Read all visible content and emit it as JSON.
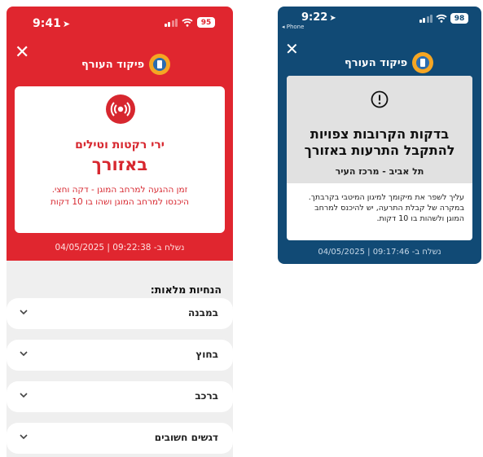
{
  "left_screen": {
    "status_bar": {
      "time": "9:41",
      "battery": "95",
      "location_icon": "location-arrow-icon"
    },
    "header": {
      "app_name": "פיקוד העורף",
      "close_icon": "close-icon",
      "logo": "home-front-command-logo"
    },
    "alert": {
      "icon": "alarm-siren-icon",
      "subtitle": "ירי רקטות וטילים",
      "title": "באזורך",
      "description_line1": "זמן ההגעה למרחב המוגן - דקה וחצי.",
      "description_line2": "היכנסו למרחב המוגן ושהו בו 10 דקות"
    },
    "sent_text": "04/05/2025 | 09:22:38 -נשלח ב",
    "instructions_header": "הנחיות מלאות:",
    "instructions": [
      {
        "label": "במבנה"
      },
      {
        "label": "בחוץ"
      },
      {
        "label": "ברכב"
      },
      {
        "label": "דגשים חשובים"
      }
    ],
    "colors": {
      "alert_red": "#e0262f",
      "background": "#efefef"
    }
  },
  "right_screen": {
    "status_bar": {
      "time": "9:22",
      "back_label": "◂ Phone",
      "battery": "98"
    },
    "header": {
      "app_name": "פיקוד העורף",
      "close_icon": "close-icon",
      "logo": "home-front-command-logo"
    },
    "info": {
      "icon": "exclamation-circle-icon",
      "title_line1": "בדקות הקרובות צפויות",
      "title_line2": "להתקבל התרעות באזורך",
      "location": "תל אביב - מרכז העיר",
      "description_line1": "עליך לשפר את מיקומך למיגון המיטבי בקרבתך.",
      "description_line2": "במקרה של קבלת התרעה, יש להיכנס למרחב",
      "description_line3": "המוגן ולשהות בו 10 דקות."
    },
    "sent_text": "04/05/2025 | 09:17:46 -נשלח ב",
    "colors": {
      "background": "#114a75",
      "card_top": "#e1e1e1"
    }
  }
}
